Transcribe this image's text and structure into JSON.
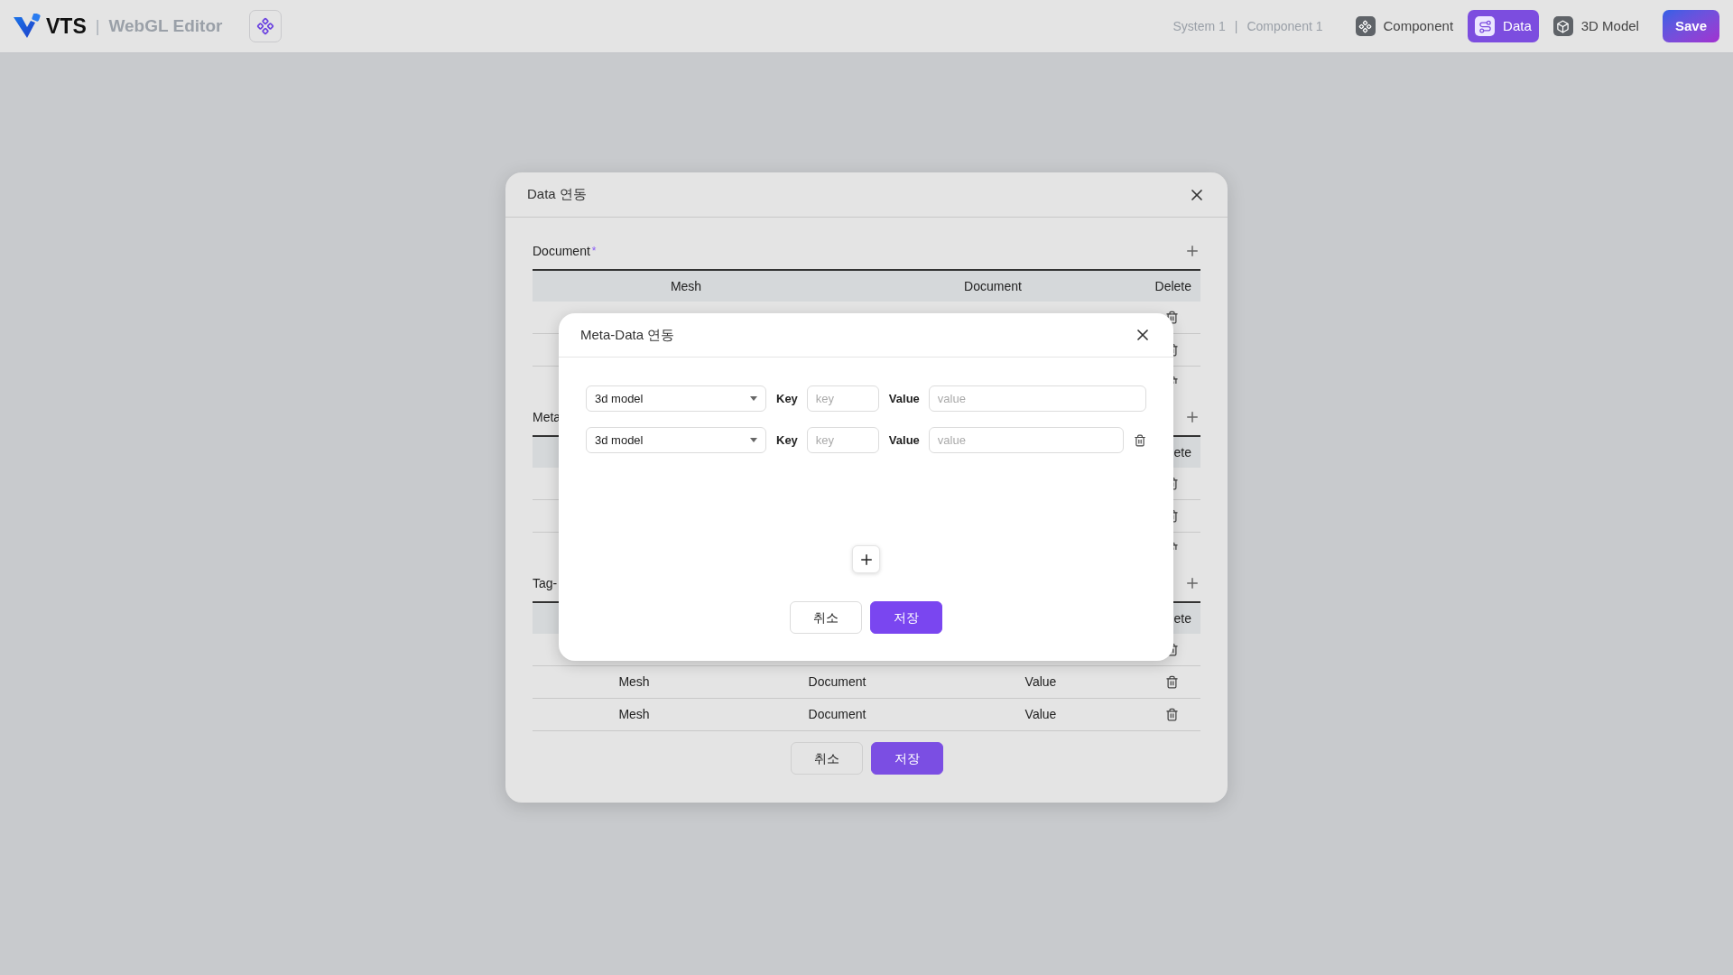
{
  "app": {
    "brand": "VTS",
    "divider": "|",
    "title": "WebGL Editor"
  },
  "breadcrumb": {
    "items": [
      "System 1",
      "Component 1"
    ],
    "separator": "|"
  },
  "tabs": [
    {
      "label": "Component",
      "selected": false,
      "kind": "component"
    },
    {
      "label": "Data",
      "selected": true,
      "kind": "data"
    },
    {
      "label": "3D Model",
      "selected": false,
      "kind": "model"
    }
  ],
  "save_button": "Save",
  "data_dialog": {
    "title": "Data 연동",
    "sections": [
      {
        "title": "Document",
        "required_mark": "*",
        "kind": "full",
        "columns": [
          "Mesh",
          "Document",
          "Delete"
        ],
        "rows": [
          {
            "kind": "covered"
          },
          {
            "kind": "covered"
          },
          {
            "kind": "covered"
          }
        ]
      },
      {
        "title": "Meta",
        "kind": "covered",
        "columns": [
          "ete"
        ],
        "rows": [
          {
            "kind": "covered"
          },
          {
            "kind": "covered"
          },
          {
            "kind": "covered"
          }
        ]
      },
      {
        "title": "Tag-",
        "kind": "covered",
        "columns": [
          "ete"
        ],
        "rows": [
          {
            "kind": "covered"
          },
          {
            "kind": "data",
            "cells": [
              "Mesh",
              "Document",
              "Value"
            ]
          },
          {
            "kind": "data",
            "cells": [
              "Mesh",
              "Document",
              "Value"
            ]
          }
        ]
      }
    ],
    "buttons": [
      {
        "label": "취소",
        "kind": "secondary"
      },
      {
        "label": "저장",
        "kind": "primary"
      }
    ]
  },
  "meta_dialog": {
    "title": "Meta-Data 연동",
    "rows": [
      {
        "type": "3d model",
        "key_label": "Key",
        "key_placeholder": "key",
        "value_label": "Value",
        "value_placeholder": "value",
        "deletable": false
      },
      {
        "type": "3d model",
        "key_label": "Key",
        "key_placeholder": "key",
        "value_label": "Value",
        "value_placeholder": "value",
        "deletable": true
      }
    ],
    "buttons": [
      {
        "label": "취소",
        "kind": "secondary"
      },
      {
        "label": "저장",
        "kind": "primary"
      }
    ]
  }
}
